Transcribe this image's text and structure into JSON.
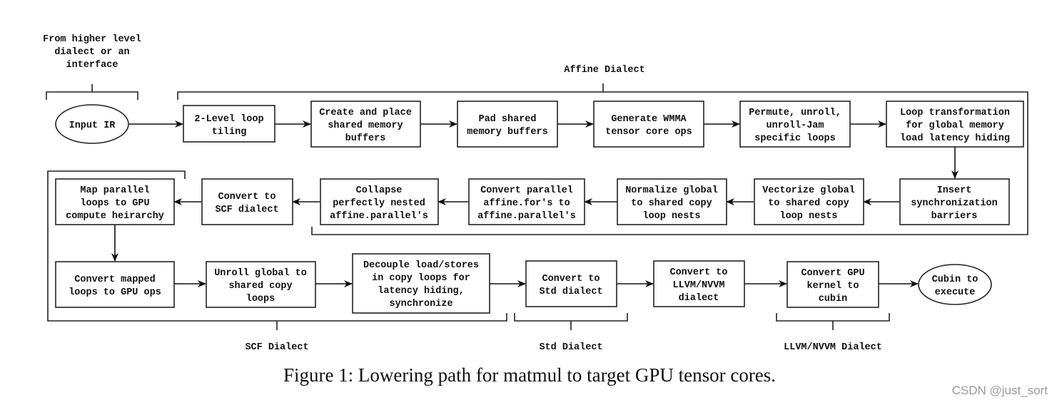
{
  "figure": {
    "caption": "Figure 1: Lowering path for matmul to target GPU tensor cores.",
    "watermark": "CSDN @just_sort"
  },
  "groups": {
    "input_source": "From higher level\ndialect or an\ninterface",
    "affine": "Affine Dialect",
    "scf": "SCF Dialect",
    "std": "Std Dialect",
    "llvm": "LLVM/NVVM Dialect"
  },
  "nodes": {
    "input_ir": "Input IR",
    "tiling": "2-Level loop\ntiling",
    "create_buffers": "Create and place\nshared memory\nbuffers",
    "pad_buffers": "Pad shared\nmemory buffers",
    "wmma": "Generate WMMA\ntensor core ops",
    "permute": "Permute, unroll,\nunroll-Jam\nspecific loops",
    "latency_hiding": "Loop transformation\nfor global memory\nload latency hiding",
    "sync_barriers": "Insert\nsynchronization\nbarriers",
    "vectorize": "Vectorize global\nto shared copy\nloop nests",
    "normalize": "Normalize global\nto shared copy\nloop nests",
    "convert_parallel": "Convert parallel\naffine.for's to\naffine.parallel's",
    "collapse": "Collapse\nperfectly nested\naffine.parallel's",
    "to_scf": "Convert to\nSCF dialect",
    "map_parallel": "Map parallel\nloops to GPU\ncompute heirarchy",
    "to_gpu_ops": "Convert mapped\nloops to GPU ops",
    "unroll_copy": "Unroll global to\nshared copy\nloops",
    "decouple": "Decouple load/stores\nin copy loops for\nlatency hiding,\nsynchronize",
    "to_std": "Convert to\nStd dialect",
    "to_llvm": "Convert to\nLLVM/NVVM\ndialect",
    "to_cubin": "Convert GPU\nkernel to\ncubin",
    "cubin_exec": "Cubin to\nexecute"
  }
}
